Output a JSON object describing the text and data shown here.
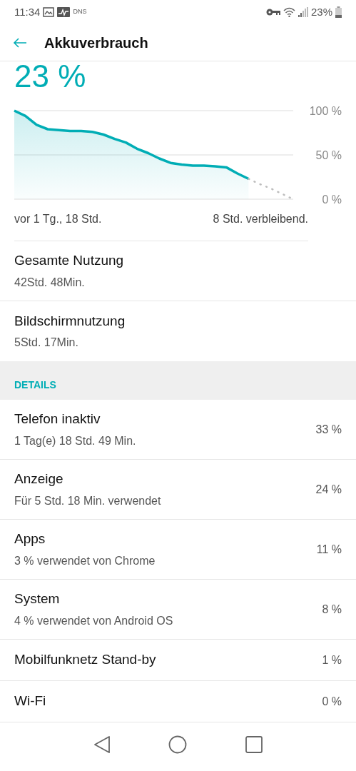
{
  "status_bar": {
    "time": "11:34",
    "notification_text": "DNS",
    "battery_text": "23%"
  },
  "app_bar": {
    "title": "Akkuverbrauch"
  },
  "battery_level": "23 %",
  "chart_data": {
    "type": "area",
    "ylim": [
      0,
      100
    ],
    "yticks": [
      {
        "value": 100,
        "label": "100 %"
      },
      {
        "value": 50,
        "label": "50 %"
      },
      {
        "value": 0,
        "label": "0 %"
      }
    ],
    "series": [
      {
        "color": "#00adb5",
        "values": [
          100,
          94,
          84,
          79,
          78,
          77,
          77,
          76,
          73,
          68,
          64,
          57,
          52,
          46,
          41,
          39,
          38,
          38,
          37,
          36,
          29,
          23,
          null,
          null,
          null,
          null
        ]
      },
      {
        "color": "#bdbdbd",
        "type": "line",
        "line_style": "dotted",
        "values": [
          null,
          null,
          null,
          null,
          null,
          null,
          null,
          null,
          null,
          null,
          null,
          null,
          null,
          null,
          null,
          null,
          null,
          null,
          null,
          null,
          null,
          23,
          17,
          12,
          6,
          0
        ]
      }
    ]
  },
  "chart_captions": {
    "start": "vor 1 Tg., 18 Std.",
    "end": "8 Std. verbleibend."
  },
  "summary": [
    {
      "title": "Gesamte Nutzung",
      "subtitle": "42Std. 48Min."
    },
    {
      "title": "Bildschirmnutzung",
      "subtitle": "5Std. 17Min."
    }
  ],
  "details_header": "DETAILS",
  "details": [
    {
      "title": "Telefon inaktiv",
      "subtitle": "1 Tag(e) 18 Std. 49 Min.",
      "value": "33 %"
    },
    {
      "title": "Anzeige",
      "subtitle": "Für 5 Std. 18 Min. verwendet",
      "value": "24 %"
    },
    {
      "title": "Apps",
      "subtitle": "3 % verwendet von Chrome",
      "value": "11 %"
    },
    {
      "title": "System",
      "subtitle": "4 % verwendet von Android OS",
      "value": "8 %"
    },
    {
      "title": "Mobilfunknetz Stand-by",
      "value": "1 %"
    },
    {
      "title": "Wi-Fi",
      "value": "0 %"
    }
  ]
}
